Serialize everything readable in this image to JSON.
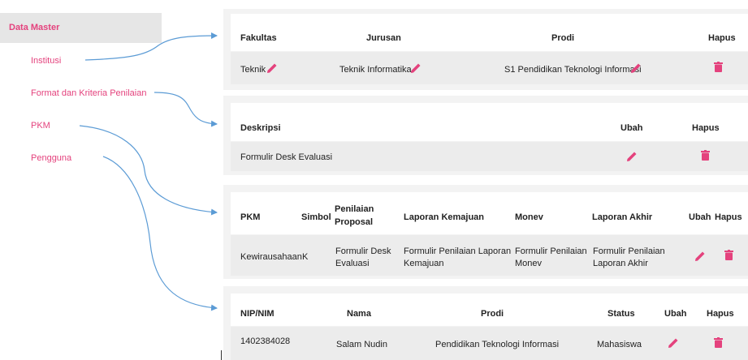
{
  "sidebar": {
    "title": "Data Master",
    "items": [
      {
        "label": "Institusi"
      },
      {
        "label": "Format dan Kriteria Penilaian"
      },
      {
        "label": "PKM"
      },
      {
        "label": "Pengguna"
      }
    ]
  },
  "institusi_table": {
    "headers": [
      "Fakultas",
      "Jurusan",
      "Prodi",
      "Hapus"
    ],
    "row": {
      "fakultas": "Teknik",
      "jurusan": "Teknik Informatika",
      "prodi": "S1 Pendidikan Teknologi Informasi"
    }
  },
  "format_table": {
    "headers": [
      "Deskripsi",
      "Ubah",
      "Hapus"
    ],
    "row": {
      "deskripsi": "Formulir Desk Evaluasi"
    }
  },
  "pkm_table": {
    "headers": [
      "PKM",
      "Simbol",
      "Penilaian Proposal",
      "Laporan Kemajuan",
      "Monev",
      "Laporan Akhir",
      "Ubah",
      "Hapus"
    ],
    "header_lines": {
      "penilaian_1": "Penilaian",
      "penilaian_2": "Proposal"
    },
    "row": {
      "pkm": "Kewirausahaan",
      "simbol": "K",
      "penilaian_1": "Formulir Desk",
      "penilaian_2": "Evaluasi",
      "kemajuan_1": "Formulir Penilaian Laporan",
      "kemajuan_2": "Kemajuan",
      "monev_1": "Formulir Penilaian",
      "monev_2": "Monev",
      "akhir_1": "Formulir Penilaian",
      "akhir_2": "Laporan Akhir"
    }
  },
  "pengguna_table": {
    "headers": [
      "NIP/NIM",
      "Nama",
      "Prodi",
      "Status",
      "Ubah",
      "Hapus"
    ],
    "row": {
      "nip": "1402384028",
      "nama": "Salam Nudin",
      "prodi": "Pendidikan Teknologi Informasi",
      "status": "Mahasiswa"
    }
  },
  "colors": {
    "accent": "#e4427d",
    "arrow": "#5b9bd5",
    "panel": "#f3f3f3",
    "row": "#ececec"
  },
  "icons": {
    "edit": "pencil-icon",
    "delete": "trash-icon"
  }
}
